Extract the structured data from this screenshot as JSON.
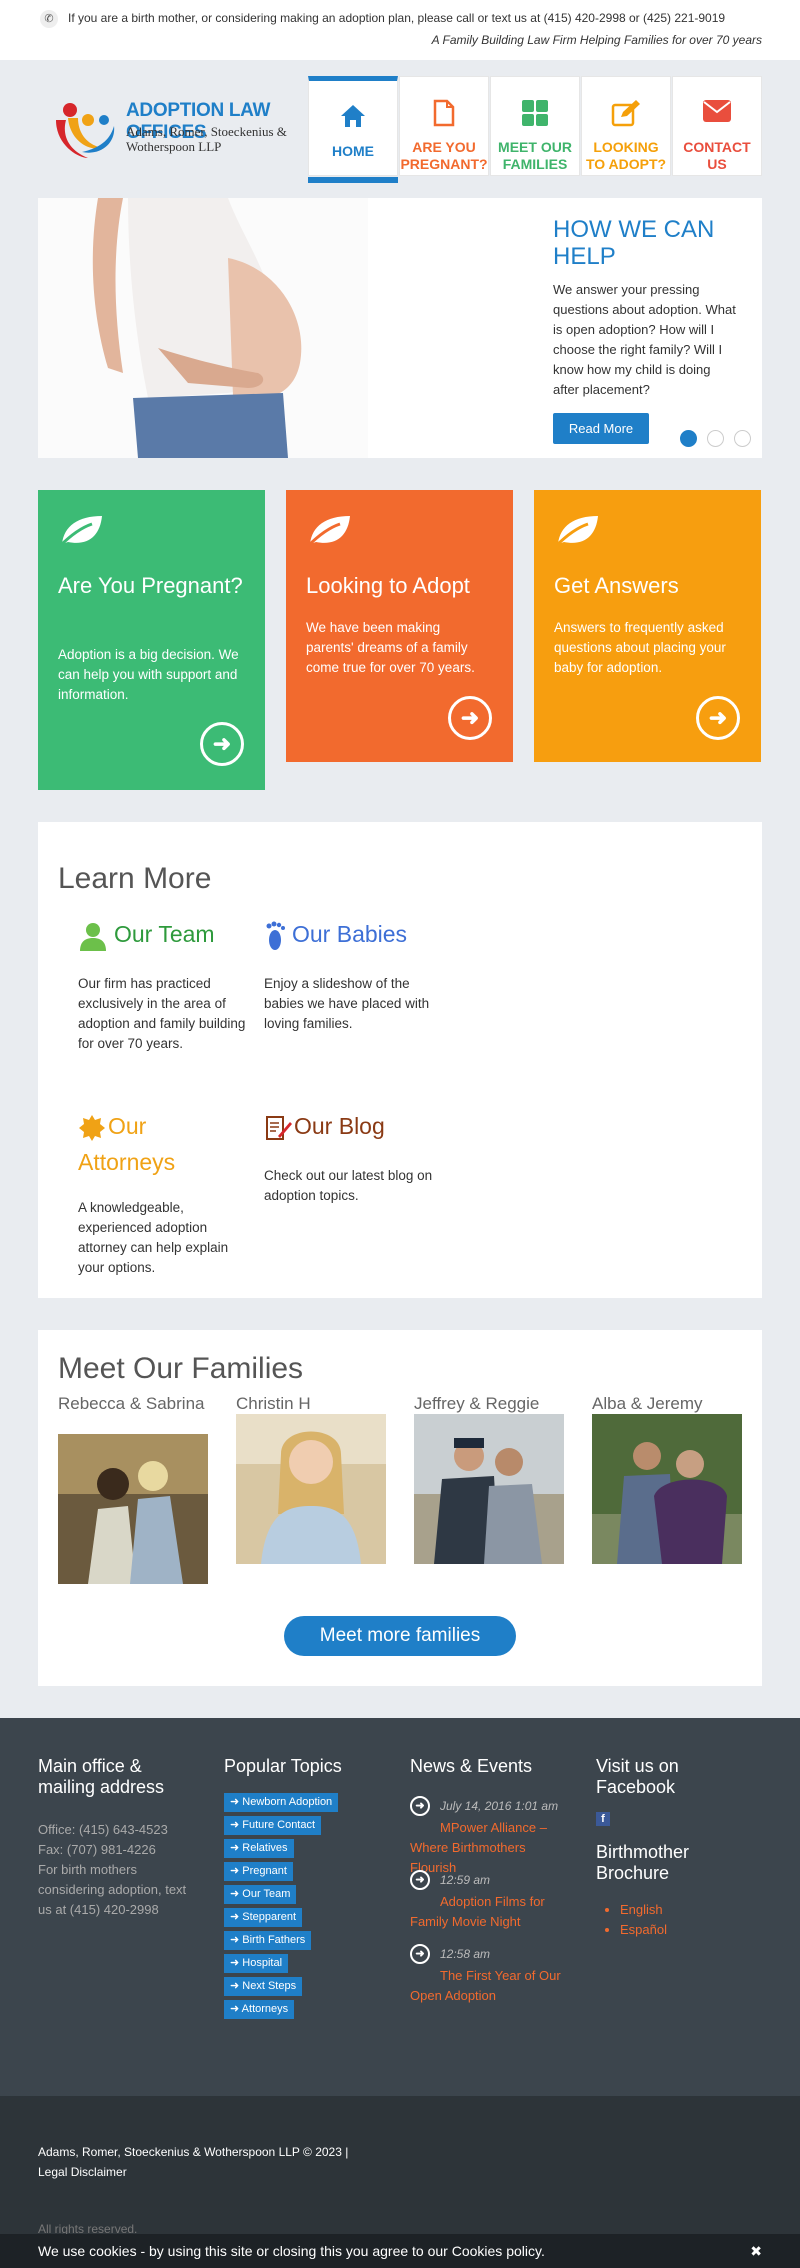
{
  "topbar": {
    "message": "If you are a birth mother, or considering making an adoption plan, please call or text us at (415) 420-2998 or (425) 221-9019",
    "tagline": "A Family Building Law Firm Helping Families for over 70 years"
  },
  "logo": {
    "title": "ADOPTION LAW OFFICES",
    "subtitle": "Adams, Romer, Stoeckenius & Wotherspoon LLP"
  },
  "nav": [
    {
      "label": "HOME",
      "icon": "home-icon",
      "color": "#1f7fc8"
    },
    {
      "label": "ARE YOU PREGNANT?",
      "icon": "document-icon",
      "color": "#f26a2e"
    },
    {
      "label": "MEET OUR FAMILIES",
      "icon": "grid-icon",
      "color": "#3fb46b"
    },
    {
      "label": "LOOKING TO ADOPT?",
      "icon": "edit-icon",
      "color": "#f5a00a"
    },
    {
      "label": "CONTACT US",
      "icon": "envelope-icon",
      "color": "#e94e3d"
    }
  ],
  "hero": {
    "title": "HOW WE CAN HELP",
    "body": "We answer your pressing questions about adoption. What is open adoption? How will I choose the right family? Will I know how my child is doing after placement?",
    "button": "Read More"
  },
  "cards": [
    {
      "title": "Are You Pregnant?",
      "body": "Adoption is a big decision. We can help you with support and information.",
      "color": "#3cbb75"
    },
    {
      "title": "Looking to Adopt",
      "body": "We have been making parents' dreams of a family come true for over 70 years.",
      "color": "#f26a2e"
    },
    {
      "title": "Get Answers",
      "body": "Answers to frequently asked questions about placing your baby for adoption.",
      "color": "#f79e0f"
    }
  ],
  "learn": {
    "heading": "Learn More",
    "items": [
      {
        "title": "Our Team",
        "body": "Our firm has practiced exclusively in the area of adoption and family building for over 70 years.",
        "color": "#2e9a3c"
      },
      {
        "title": "Our Babies",
        "body": "Enjoy a slideshow of the babies we have placed with loving families.",
        "color": "#3d6fd6"
      },
      {
        "title": "Our Attorneys",
        "body": "A knowledgeable, experienced adoption attorney can help explain your options.",
        "color": "#f0a215"
      },
      {
        "title": "Our Blog",
        "body": "Check out our latest blog on adoption topics.",
        "color": "#8a3a14"
      }
    ]
  },
  "families": {
    "heading": "Meet Our Families",
    "list": [
      "Rebecca & Sabrina",
      "Christin H",
      "Jeffrey & Reggie",
      "Alba & Jeremy"
    ],
    "button": "Meet more families"
  },
  "footer": {
    "office_heading": "Main office & mailing address",
    "office_lines": [
      "Office: (415) 643-4523",
      "Fax: (707) 981-4226",
      "For birth mothers considering adoption, text us at (415) 420-2998"
    ],
    "topics_heading": "Popular Topics",
    "topics": [
      "Newborn Adoption",
      "Future Contact",
      "Relatives",
      "Pregnant",
      "Our Team",
      "Stepparent",
      "Birth Fathers",
      "Hospital",
      "Next Steps",
      "Attorneys"
    ],
    "news_heading": "News & Events",
    "news": [
      {
        "date": "July 14, 2016 1:01 am",
        "title": "MPower Alliance – Where Birthmothers Flourish"
      },
      {
        "date": "12:59 am",
        "title": "Adoption Films for Family Movie Night"
      },
      {
        "date": "12:58 am",
        "title": "The First Year of Our Open Adoption"
      }
    ],
    "facebook_heading": "Visit us on Facebook",
    "brochure_heading": "Birthmother Brochure",
    "brochure_links": [
      "English",
      "Español"
    ]
  },
  "bottom": {
    "copyright": "Adams, Romer, Stoeckenius & Wotherspoon LLP © 2023 |",
    "legal": "Legal Disclaimer",
    "rights": "All rights reserved."
  },
  "cookie": {
    "text": "We use cookies - by using this site or closing this you agree to our Cookies policy.",
    "close": "✖"
  }
}
